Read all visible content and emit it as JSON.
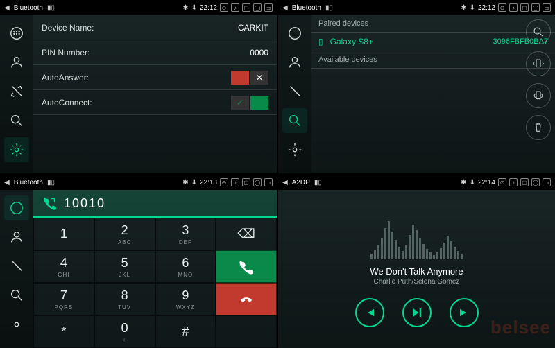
{
  "pane1": {
    "title": "Bluetooth",
    "time": "22:12",
    "rows": {
      "device_label": "Device Name:",
      "device_value": "CARKIT",
      "pin_label": "PIN Number:",
      "pin_value": "0000",
      "auto_answer_label": "AutoAnswer:",
      "auto_answer_value": false,
      "auto_connect_label": "AutoConnect:",
      "auto_connect_value": true
    },
    "active_tab": "settings"
  },
  "pane2": {
    "title": "Bluetooth",
    "time": "22:12",
    "paired_header": "Paired devices",
    "available_header": "Available devices",
    "device": {
      "name": "Galaxy S8+",
      "mac": "3096FBFB0BA7"
    },
    "active_tab": "search"
  },
  "pane3": {
    "title": "Bluetooth",
    "time": "22:13",
    "number": "10010",
    "keys": [
      {
        "d": "1",
        "l": ""
      },
      {
        "d": "2",
        "l": "ABC"
      },
      {
        "d": "3",
        "l": "DEF"
      },
      {
        "d": "⌫",
        "l": "",
        "type": "back"
      },
      {
        "d": "4",
        "l": "GHI"
      },
      {
        "d": "5",
        "l": "JKL"
      },
      {
        "d": "6",
        "l": "MNO"
      },
      {
        "d": "",
        "l": "",
        "type": "call"
      },
      {
        "d": "7",
        "l": "PQRS"
      },
      {
        "d": "8",
        "l": "TUV"
      },
      {
        "d": "9",
        "l": "WXYZ"
      },
      {
        "d": "",
        "l": "",
        "type": "hang"
      },
      {
        "d": "*",
        "l": ""
      },
      {
        "d": "0",
        "l": "+"
      },
      {
        "d": "#",
        "l": ""
      },
      {
        "d": "",
        "l": "",
        "type": "empty"
      }
    ],
    "active_tab": "dial"
  },
  "pane4": {
    "title": "A2DP",
    "time": "22:14",
    "song_title": "We Don't Talk Anymore",
    "song_artist": "Charlie Puth/Selena Gomez",
    "watermark": "belsee"
  }
}
